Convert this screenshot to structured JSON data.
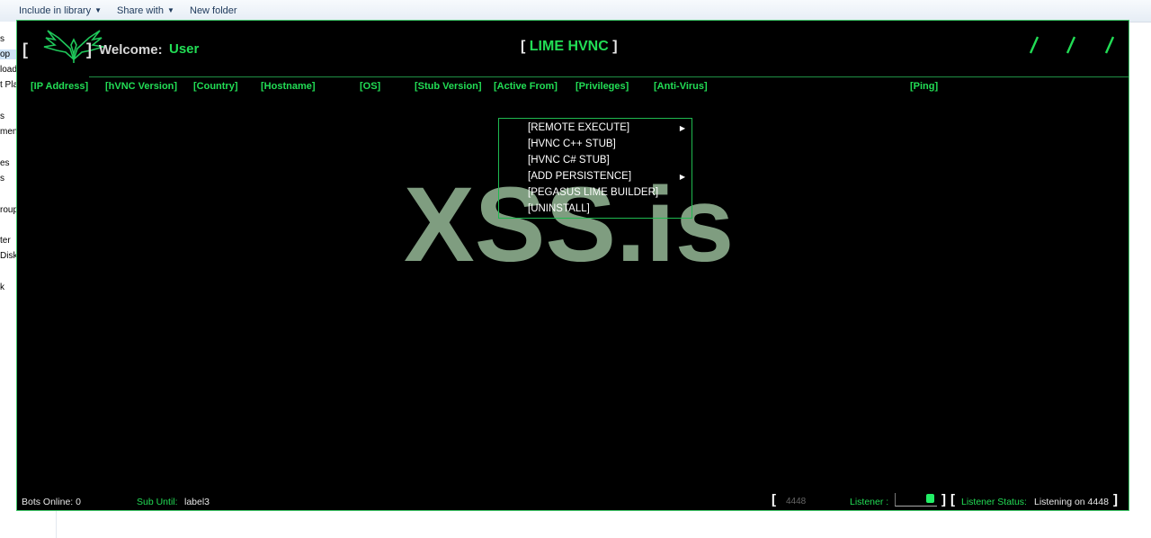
{
  "toolbar": {
    "include_in_library": "Include in library",
    "share_with": "Share with",
    "new_folder": "New folder"
  },
  "leftnav": [
    "s",
    "op",
    "load",
    "t Pla",
    "s",
    "ment",
    "es",
    "s",
    "roup",
    "ter",
    "Disk",
    "k"
  ],
  "app": {
    "bracket_open": "[",
    "bracket_close": "]",
    "welcome_label": "Welcome:",
    "user": "User",
    "title_open": "[",
    "title": "LIME HVNC",
    "title_close": "]"
  },
  "columns": [
    "[IP Address]",
    "[hVNC Version]",
    "[Country]",
    "[Hostname]",
    "[OS]",
    "[Stub Version]",
    "[Active From]",
    "[Privileges]",
    "[Anti-Virus]",
    "[Ping]"
  ],
  "context_menu": [
    {
      "label": "[REMOTE EXECUTE]",
      "submenu": true
    },
    {
      "label": "[HVNC C++ STUB]",
      "submenu": false
    },
    {
      "label": "[HVNC C# STUB]",
      "submenu": false
    },
    {
      "label": "[ADD PERSISTENCE]",
      "submenu": true
    },
    {
      "label": "[PEGASUS LIME BUILDER]",
      "submenu": false
    },
    {
      "label": "[UNINSTALL]",
      "submenu": false
    }
  ],
  "watermark": "XSS.is",
  "status": {
    "bots_online": "Bots Online: 0",
    "sub_until_label": "Sub Until:",
    "sub_until_value": "label3",
    "port": "4448",
    "listener_label": "Listener :",
    "listener_on": true,
    "listener_status_label": "Listener Status:",
    "listener_status_value": "Listening on 4448"
  },
  "colors": {
    "accent": "#22dd55",
    "border": "#41c86a",
    "background": "#000000",
    "watermark": "#7f9d80"
  }
}
